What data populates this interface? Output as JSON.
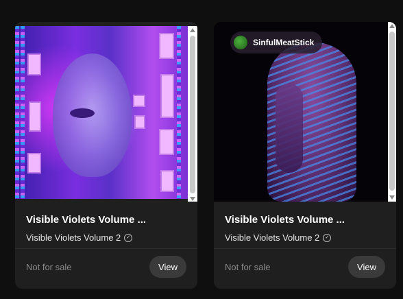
{
  "cards": [
    {
      "title": "Visible Violets Volume ...",
      "collection": "Visible Violets Volume 2",
      "status": "Not for sale",
      "action": "View"
    },
    {
      "owner": "SinfulMeatStick",
      "title": "Visible Violets Volume ...",
      "collection": "Visible Violets Volume 2",
      "status": "Not for sale",
      "action": "View"
    }
  ],
  "icons": {
    "verified": "verified-check-icon"
  },
  "colors": {
    "background": "#0f0f0f",
    "card": "#1f1f1f",
    "button": "#3a3a3a",
    "muted_text": "#8a8a8a"
  }
}
